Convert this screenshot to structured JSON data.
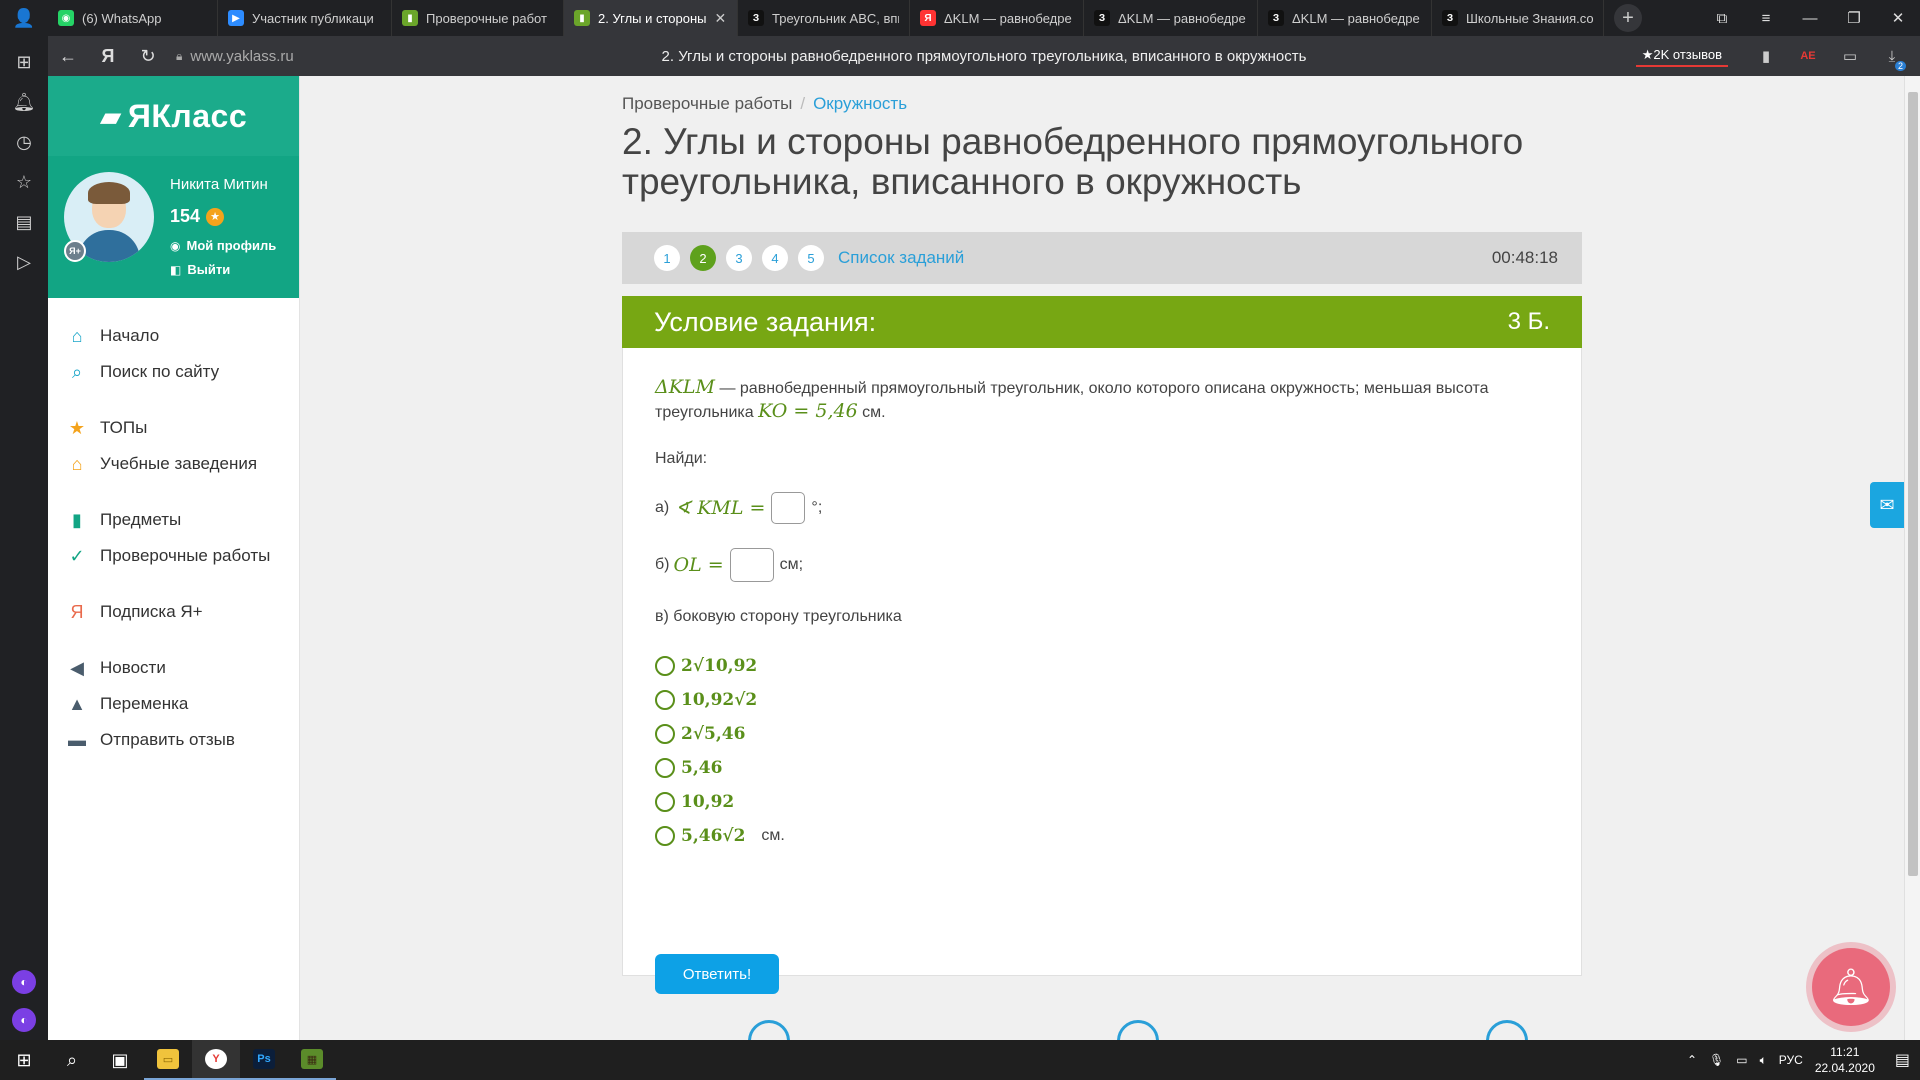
{
  "browser": {
    "tabs": [
      {
        "title": "(6) WhatsApp",
        "icon": "whatsapp-icon",
        "color": "#25d366",
        "glyph": "◉",
        "active": false,
        "width": 170
      },
      {
        "title": "Участник публикаци",
        "icon": "video-icon",
        "color": "#2d8cff",
        "glyph": "▶",
        "active": false,
        "width": 174
      },
      {
        "title": "Проверочные работ",
        "icon": "yaklass-icon",
        "color": "#6ba52a",
        "glyph": "▮",
        "active": false,
        "width": 172
      },
      {
        "title": "2. Углы и стороны",
        "icon": "yaklass-icon",
        "color": "#6ba52a",
        "glyph": "▮",
        "active": true,
        "width": 174
      },
      {
        "title": "Треугольник ABC, впи",
        "icon": "znanija-icon",
        "color": "#111111",
        "glyph": "З",
        "active": false,
        "width": 172
      },
      {
        "title": "ΔKLM — равнобедре",
        "icon": "yandex-icon",
        "color": "#ff3333",
        "glyph": "Я",
        "active": false,
        "width": 174
      },
      {
        "title": "ΔKLM — равнобедре",
        "icon": "znanija-icon",
        "color": "#111111",
        "glyph": "З",
        "active": false,
        "width": 174
      },
      {
        "title": "ΔKLM — равнобедре",
        "icon": "znanija-icon",
        "color": "#111111",
        "glyph": "З",
        "active": false,
        "width": 174
      },
      {
        "title": "Школьные Знания.со",
        "icon": "znanija-icon",
        "color": "#111111",
        "glyph": "З",
        "active": false,
        "width": 172
      }
    ],
    "url": "www.yaklass.ru",
    "page_title": "2. Углы и стороны равнобедренного прямоугольного треугольника, вписанного в окружность",
    "reviews": "★2K отзывов",
    "badge": "2"
  },
  "site": {
    "logo": "ЯКласс",
    "user": {
      "name": "Никита Митин",
      "points": "154",
      "profile_link": "Мой профиль",
      "logout_link": "Выйти"
    },
    "menu_groups": [
      [
        {
          "label": "Начало",
          "icon": "home-icon",
          "glyph": "⌂",
          "color": "#1ba6c9"
        },
        {
          "label": "Поиск по сайту",
          "icon": "search-icon",
          "glyph": "⌕",
          "color": "#1ba6c9"
        }
      ],
      [
        {
          "label": "ТОПы",
          "icon": "star-icon",
          "glyph": "★",
          "color": "#f4a31c"
        },
        {
          "label": "Учебные заведения",
          "icon": "school-icon",
          "glyph": "⌂",
          "color": "#f4a31c"
        }
      ],
      [
        {
          "label": "Предметы",
          "icon": "books-icon",
          "glyph": "▮",
          "color": "#12a584"
        },
        {
          "label": "Проверочные работы",
          "icon": "check-circle-icon",
          "glyph": "✓",
          "color": "#12a584"
        }
      ],
      [
        {
          "label": "Подписка Я+",
          "icon": "ya-plus-icon",
          "glyph": "Я",
          "color": "#e96a4c"
        }
      ],
      [
        {
          "label": "Новости",
          "icon": "megaphone-icon",
          "glyph": "◀",
          "color": "#4a5c6c"
        },
        {
          "label": "Переменка",
          "icon": "bell-icon",
          "glyph": "▲",
          "color": "#4a5c6c"
        },
        {
          "label": "Отправить отзыв",
          "icon": "comment-icon",
          "glyph": "▬",
          "color": "#4a5c6c"
        }
      ]
    ]
  },
  "main": {
    "breadcrumb": {
      "first": "Проверочные работы",
      "sep": "/",
      "second": "Окружность"
    },
    "title": "2. Углы и стороны равнобедренного прямоугольного треугольника, вписанного в окружность",
    "task_numbers": [
      "1",
      "2",
      "3",
      "4",
      "5"
    ],
    "current_task": "2",
    "task_list_link": "Список заданий",
    "timer": "00:48:18",
    "header_title": "Условие задания:",
    "score": "3 Б.",
    "condition_math1": "ΔKLM",
    "condition_text1": " — равнобедренный прямоугольный треугольник, около которого описана окружность; меньшая высота треугольника ",
    "condition_math2": "KO = 5,46",
    "condition_text2": " см.",
    "find": "Найди:",
    "qa_prefix": "а)",
    "qa_math": "∢ KML =",
    "qa_suffix": "°;",
    "qb_prefix": "б)",
    "qb_math": "OL =",
    "qb_suffix": "см;",
    "qc": "в) боковую сторону треугольника",
    "options": [
      "2√10,92",
      "10,92√2",
      "2√5,46",
      "5,46",
      "10,92",
      "5,46√2"
    ],
    "options_unit": "см.",
    "answer_button": "Ответить!"
  },
  "taskbar": {
    "lang": "РУС",
    "time": "11:21",
    "date": "22.04.2020"
  }
}
